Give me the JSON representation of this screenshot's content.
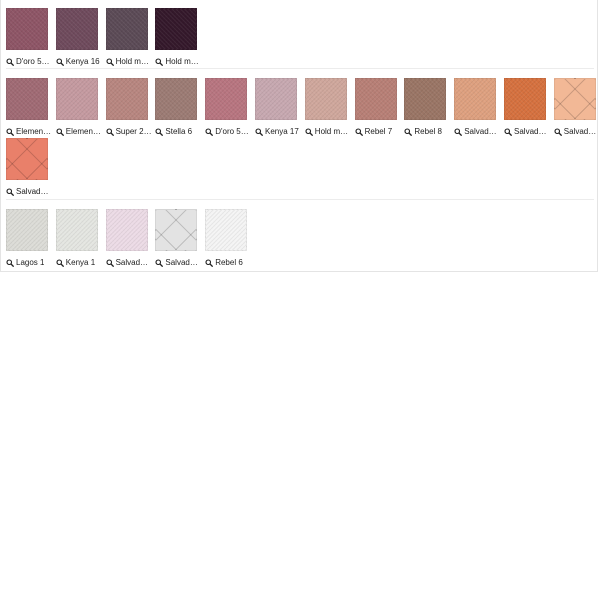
{
  "groups": [
    {
      "swatches": [
        {
          "label": "D'oro 5…",
          "color": "#8e5566",
          "texture": "fabric"
        },
        {
          "label": "Kenya 16",
          "color": "#6f4a5c",
          "texture": "fabric"
        },
        {
          "label": "Hold m…",
          "color": "#5b4a56",
          "texture": "fabric"
        },
        {
          "label": "Hold m…",
          "color": "#34182b",
          "texture": "fabric"
        }
      ]
    },
    {
      "swatches": [
        {
          "label": "Elemen…",
          "color": "#a06a74",
          "texture": "fabric"
        },
        {
          "label": "Elemen…",
          "color": "#c59aa0",
          "texture": "fabric"
        },
        {
          "label": "Super 2…",
          "color": "#b88680",
          "texture": "fabric"
        },
        {
          "label": "Stella 6",
          "color": "#9c7b74",
          "texture": "fabric"
        },
        {
          "label": "D'oro 5…",
          "color": "#b87580",
          "texture": "fabric"
        },
        {
          "label": "Kenya 17",
          "color": "#c7a8b0",
          "texture": "fabric"
        },
        {
          "label": "Hold m…",
          "color": "#cfa79c",
          "texture": "fabric"
        },
        {
          "label": "Rebel 7",
          "color": "#b87f76",
          "texture": "fabric"
        },
        {
          "label": "Rebel 8",
          "color": "#9a7565",
          "texture": "fabric"
        },
        {
          "label": "Salvad…",
          "color": "#dea07f",
          "texture": "fabric"
        },
        {
          "label": "Salvad…",
          "color": "#d6713f",
          "texture": "fabric"
        },
        {
          "label": "Salvad…",
          "color": "#f2b896",
          "texture": "quilted"
        },
        {
          "label": "Salvad…",
          "color": "#e9806a",
          "texture": "quilted"
        }
      ]
    },
    {
      "swatches": [
        {
          "label": "Lagos 1",
          "color": "#dcdcd7",
          "texture": "fabric"
        },
        {
          "label": "Kenya 1",
          "color": "#e4e6e1",
          "texture": "fabric"
        },
        {
          "label": "Salvad…",
          "color": "#ecdbe6",
          "texture": "fabric"
        },
        {
          "label": "Salvad…",
          "color": "#e3e3e3",
          "texture": "quilted"
        },
        {
          "label": "Rebel 6",
          "color": "#f4f4f4",
          "texture": "fabric"
        }
      ]
    }
  ]
}
